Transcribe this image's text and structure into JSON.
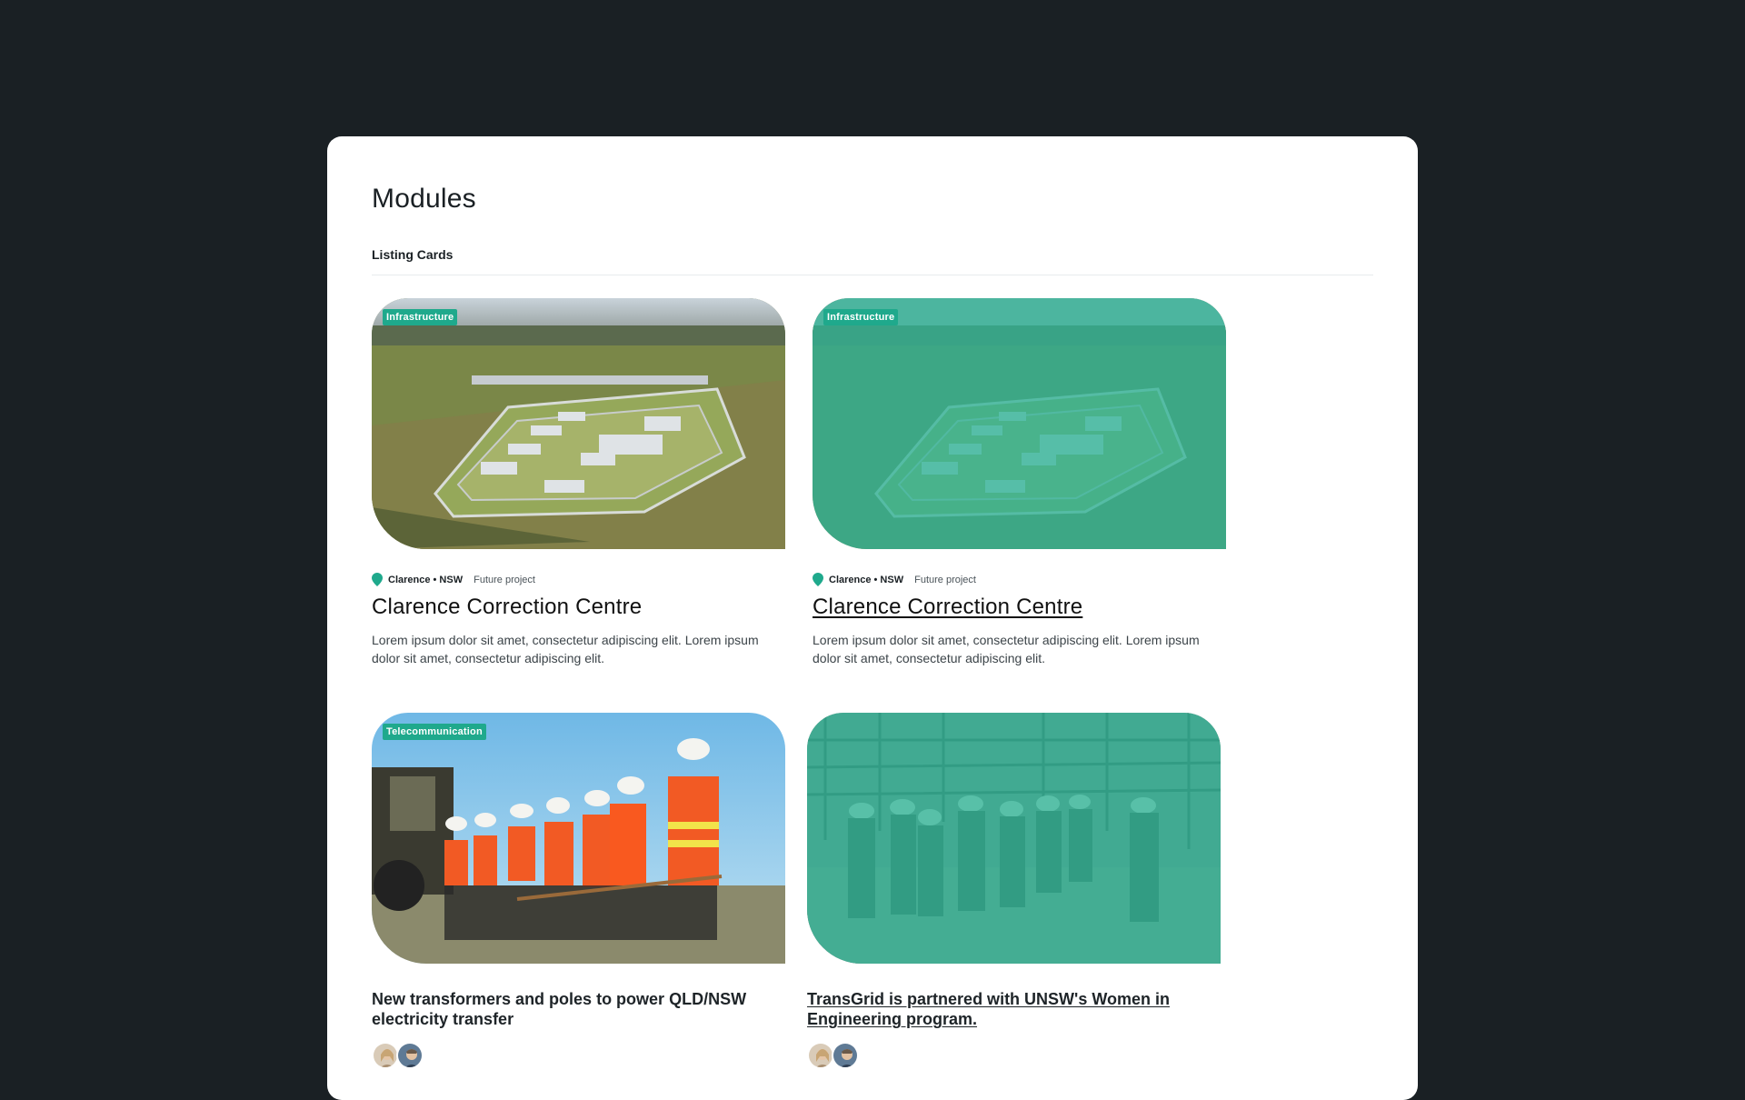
{
  "page": {
    "title": "Modules",
    "section": "Listing Cards"
  },
  "cards": [
    {
      "tag": "Infrastructure",
      "location": "Clarence • NSW",
      "status": "Future project",
      "title": "Clarence Correction Centre",
      "description": "Lorem ipsum dolor sit amet, consectetur adipiscing elit.  Lorem ipsum dolor sit amet, consectetur adipiscing elit."
    },
    {
      "tag": "Infrastructure",
      "location": "Clarence • NSW",
      "status": "Future project",
      "title": "Clarence Correction Centre",
      "description": "Lorem ipsum dolor sit amet, consectetur adipiscing elit.  Lorem ipsum dolor sit amet, consectetur adipiscing elit."
    }
  ],
  "news": [
    {
      "tag": "Telecommunication",
      "title": "New transformers and poles to power QLD/NSW electricity transfer"
    },
    {
      "tag": "",
      "title": "TransGrid is partnered with UNSW's Women in Engineering program."
    }
  ],
  "colors": {
    "accent": "#1fa98c",
    "background": "#1a2024",
    "panel": "#ffffff"
  },
  "icons": {
    "location": "map-pin-icon"
  }
}
